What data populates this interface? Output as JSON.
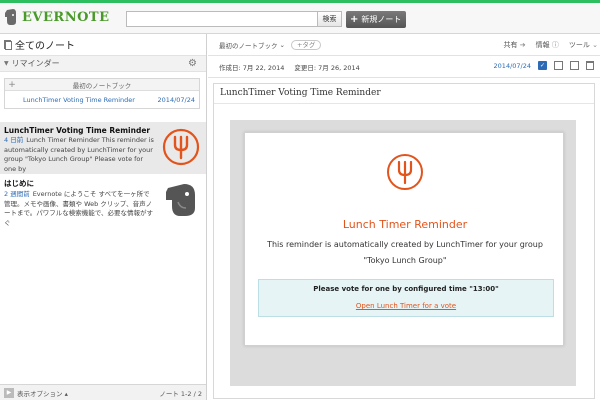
{
  "app": {
    "logo_text": "EVERNOTE"
  },
  "toolbar": {
    "search_placeholder": "",
    "search_button": "検索",
    "new_note_label": "新規ノート"
  },
  "sidebar": {
    "all_notes": "全てのノート",
    "reminders_label": "リマインダー",
    "reminder_box": {
      "notebook_label": "最初のノートブック",
      "item_title": "LunchTimer Voting Time Reminder",
      "item_date": "2014/07/24"
    },
    "notes": [
      {
        "title": "LunchTimer Voting Time Reminder",
        "date": "4 日前",
        "snippet": "Lunch Timer Reminder This reminder is automatically created by LunchTimer for your group \"Tokyo Lunch Group\" Please vote for one by"
      },
      {
        "title": "はじめに",
        "date": "2 週間前",
        "snippet": "Evernote にようこそ すべてを一ヶ所で管理。メモや画像、書類や Web クリップ、音声ノートまで。パワフルな検索機能で、必要な情報がすぐ"
      }
    ],
    "footer": {
      "options_label": "表示オプション ▴",
      "count_label": "ノート 1-2 / 2"
    }
  },
  "note_toolbar": {
    "notebook": "最初のノートブック",
    "tag_button": "+タグ",
    "share": "共有",
    "info": "情報",
    "tools": "ツール"
  },
  "note_meta": {
    "created": "作成日: 7月 22, 2014",
    "updated": "変更日: 7月 26, 2014",
    "reminder_date": "2014/07/24"
  },
  "note": {
    "title": "LunchTimer Voting Time Reminder",
    "card_title": "Lunch Timer Reminder",
    "desc_line1": "This reminder is automatically created by LunchTimer for your group",
    "desc_line2": "\"Tokyo Lunch Group\"",
    "vote_text": "Please vote for one by configured time \"13:00\"",
    "vote_link": "Open Lunch Timer for a vote"
  },
  "colors": {
    "evernote_green": "#2dbe60",
    "accent_orange": "#e2541c",
    "link_blue": "#2d6cb5"
  }
}
